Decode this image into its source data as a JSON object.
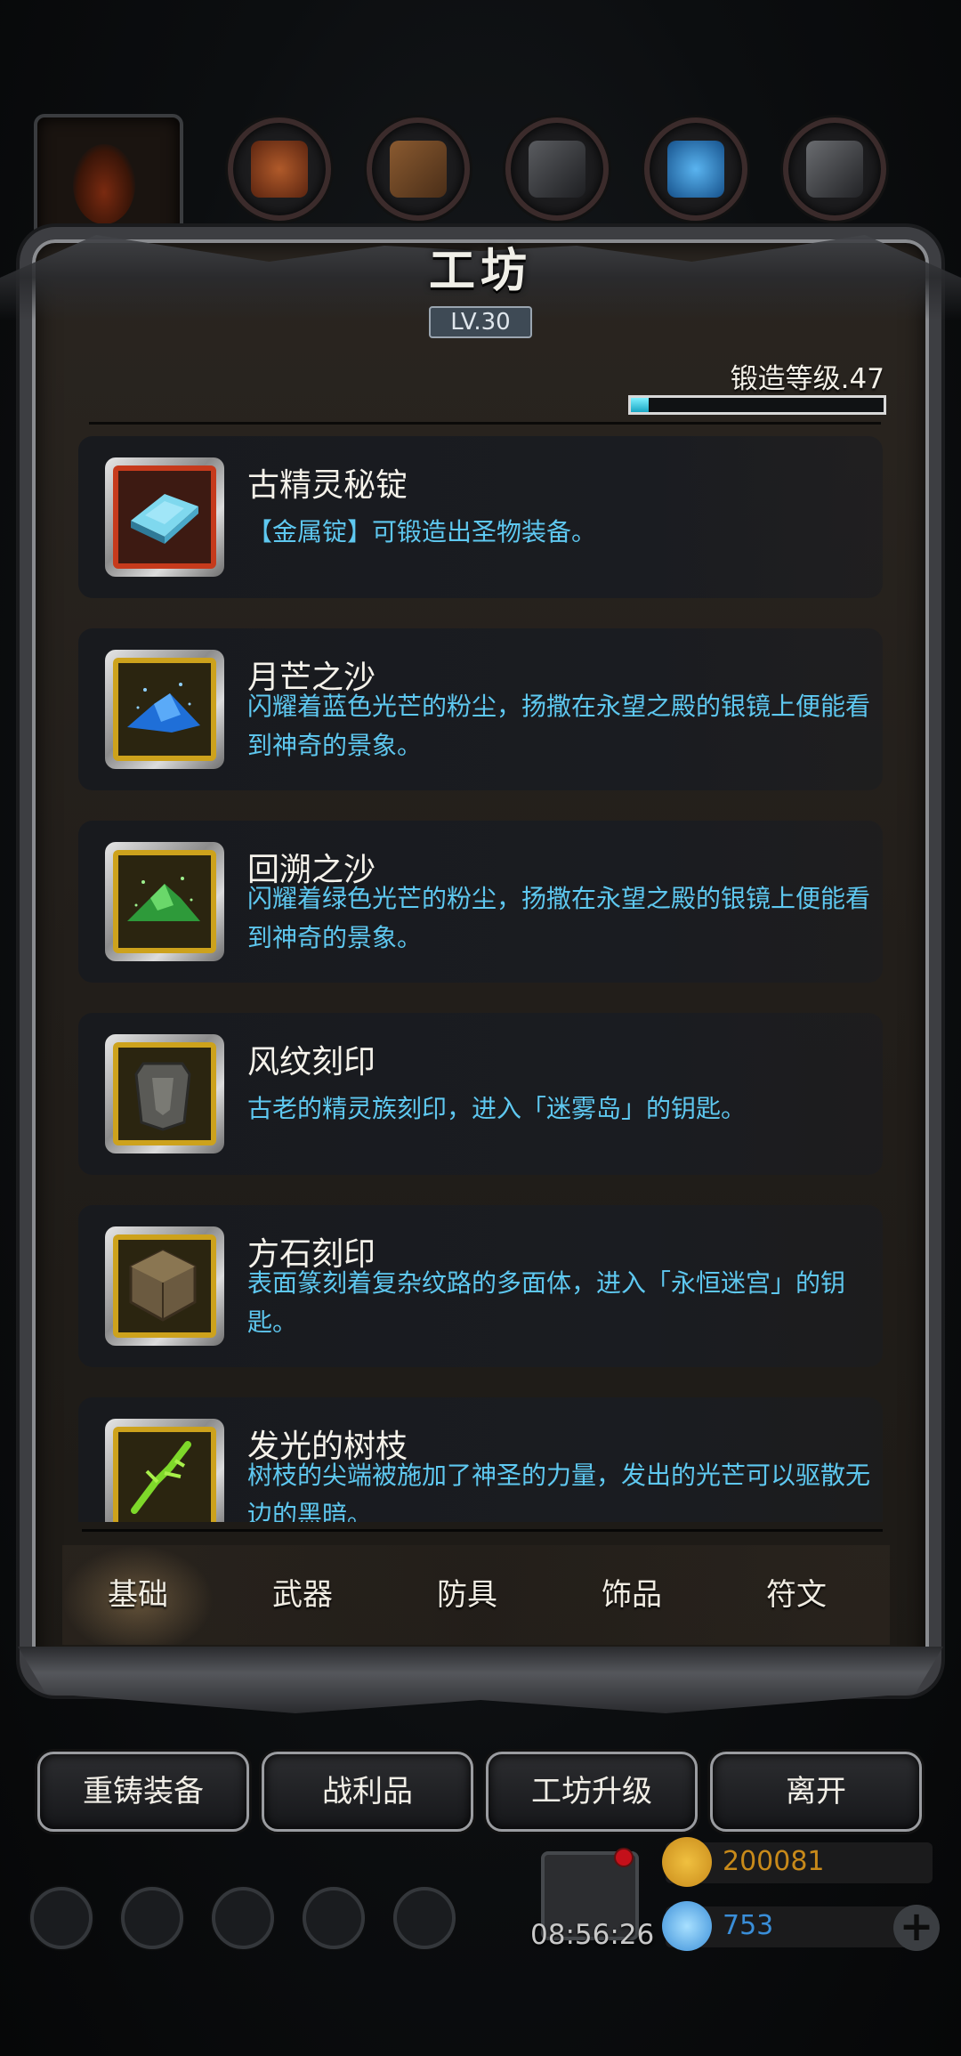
{
  "workshop": {
    "title": "工坊",
    "level_badge": "LV.30",
    "forge_level_label": "锻造等级.47",
    "forge_progress": 0.07
  },
  "items": [
    {
      "name": "古精灵秘锭",
      "desc": "【金属锭】可锻造出圣物装备。",
      "icon": "ingot-icon",
      "frame": "red"
    },
    {
      "name": "月芒之沙",
      "desc": "闪耀着蓝色光芒的粉尘，扬撒在永望之殿的银镜上便能看到神奇的景象。",
      "icon": "blue-sand-icon",
      "frame": "gold"
    },
    {
      "name": "回溯之沙",
      "desc": "闪耀着绿色光芒的粉尘，扬撒在永望之殿的银镜上便能看到神奇的景象。",
      "icon": "green-sand-icon",
      "frame": "gold"
    },
    {
      "name": "风纹刻印",
      "desc": "古老的精灵族刻印，进入「迷雾岛」的钥匙。",
      "icon": "seal-icon",
      "frame": "gold"
    },
    {
      "name": "方石刻印",
      "desc": "表面篆刻着复杂纹路的多面体，进入「永恒迷宫」的钥匙。",
      "icon": "stone-cube-icon",
      "frame": "gold"
    },
    {
      "name": "发光的树枝",
      "desc": "树枝的尖端被施加了神圣的力量，发出的光芒可以驱散无边的黑暗。",
      "icon": "glowing-branch-icon",
      "frame": "gold"
    }
  ],
  "tabs": [
    {
      "label": "基础",
      "active": true
    },
    {
      "label": "武器",
      "active": false
    },
    {
      "label": "防具",
      "active": false
    },
    {
      "label": "饰品",
      "active": false
    },
    {
      "label": "符文",
      "active": false
    }
  ],
  "buttons": {
    "reforge": "重铸装备",
    "loot": "战利品",
    "upgrade": "工坊升级",
    "leave": "离开"
  },
  "hud": {
    "timer": "08:56:26",
    "gold": "200081",
    "gems": "753",
    "gold_color": "#c88a1a",
    "gem_color": "#3a8ed8"
  },
  "colors": {
    "desc_text": "#5ec8f0",
    "progress_fill": "#4ad6ee"
  }
}
